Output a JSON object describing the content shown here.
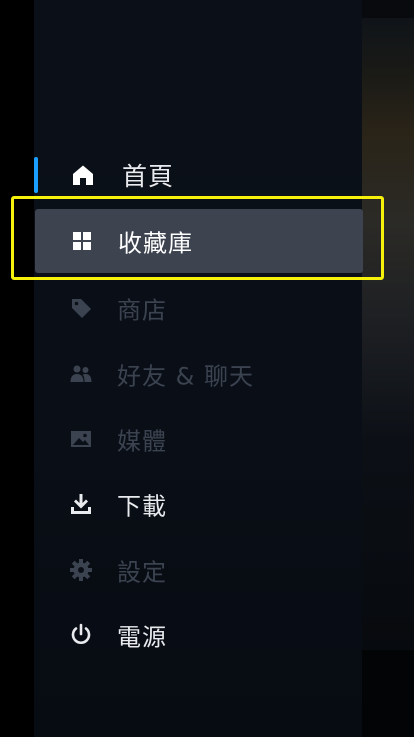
{
  "colors": {
    "active_marker": "#1a9fff",
    "focus_ring": "#f5f10a",
    "selected_bg": "#3d4450",
    "bright_text": "#ffffff",
    "dim_text": "#3b4350"
  },
  "menu": {
    "items": [
      {
        "label": "首頁",
        "icon": "home-icon",
        "state": "current"
      },
      {
        "label": "收藏庫",
        "icon": "grid-icon",
        "state": "focused"
      },
      {
        "label": "商店",
        "icon": "tag-icon",
        "state": "disabled"
      },
      {
        "label": "好友 & 聊天",
        "icon": "friends-icon",
        "state": "disabled"
      },
      {
        "label": "媒體",
        "icon": "image-icon",
        "state": "disabled"
      },
      {
        "label": "下載",
        "icon": "download-icon",
        "state": "enabled"
      },
      {
        "label": "設定",
        "icon": "gear-icon",
        "state": "disabled"
      },
      {
        "label": "電源",
        "icon": "power-icon",
        "state": "enabled"
      }
    ]
  }
}
